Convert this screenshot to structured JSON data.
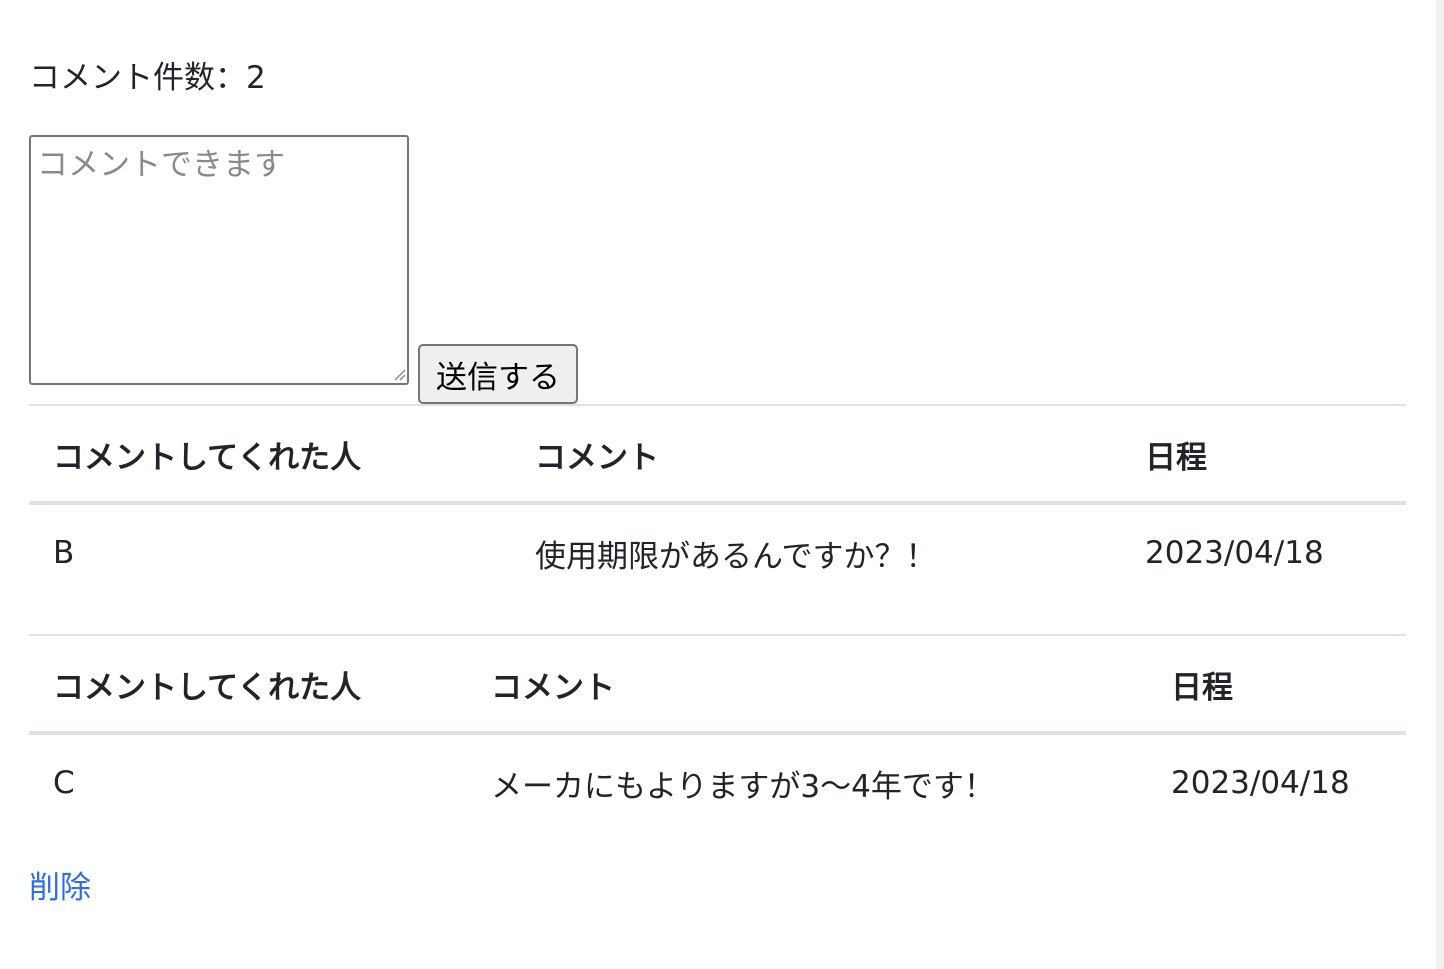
{
  "comment_count": {
    "label": "コメント件数：",
    "value": "2"
  },
  "form": {
    "placeholder": "コメントできます",
    "submit_label": "送信する"
  },
  "tables": [
    {
      "headers": [
        "コメントしてくれた人",
        "コメント",
        "日程"
      ],
      "row": {
        "name": "B",
        "comment": "使用期限があるんですか？！",
        "date": "2023/04/18"
      }
    },
    {
      "headers": [
        "コメントしてくれた人",
        "コメント",
        "日程"
      ],
      "row": {
        "name": "C",
        "comment": "メーカにもよりますが3〜4年です！",
        "date": "2023/04/18"
      }
    }
  ],
  "delete_label": "削除",
  "colors": {
    "link": "#2f6fe0",
    "border": "#dee2e6",
    "text": "#212529"
  }
}
